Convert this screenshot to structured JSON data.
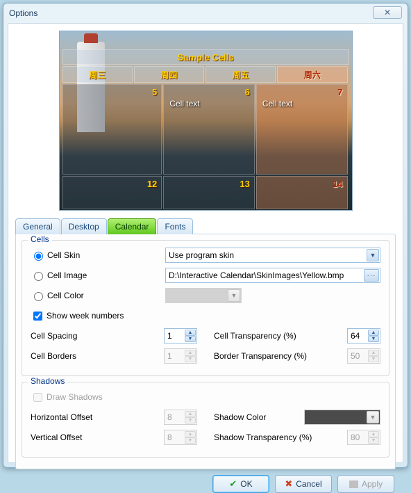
{
  "window": {
    "title": "Options",
    "close": "✕"
  },
  "preview": {
    "title": "Sample Cells",
    "day_headers": [
      "周三",
      "周四",
      "周五",
      "周六"
    ],
    "row1": [
      {
        "num": "5",
        "text": ""
      },
      {
        "num": "6",
        "text": "Cell text"
      },
      {
        "num": "7",
        "text": "Cell text"
      }
    ],
    "row2": [
      "12",
      "13",
      "14"
    ]
  },
  "tabs": {
    "general": "General",
    "desktop": "Desktop",
    "calendar": "Calendar",
    "fonts": "Fonts"
  },
  "cells": {
    "title": "Cells",
    "cell_skin_label": "Cell Skin",
    "cell_skin_value": "Use program skin",
    "cell_image_label": "Cell Image",
    "cell_image_value": "D:\\Interactive Calendar\\SkinImages\\Yellow.bmp",
    "cell_color_label": "Cell Color",
    "show_week_numbers": "Show week numbers",
    "cell_spacing_label": "Cell Spacing",
    "cell_spacing_value": "1",
    "cell_transparency_label": "Cell Transparency (%)",
    "cell_transparency_value": "64",
    "cell_borders_label": "Cell Borders",
    "cell_borders_value": "1",
    "border_transparency_label": "Border Transparency (%)",
    "border_transparency_value": "50"
  },
  "shadows": {
    "title": "Shadows",
    "draw_shadows": "Draw Shadows",
    "horizontal_offset_label": "Horizontal Offset",
    "horizontal_offset_value": "8",
    "vertical_offset_label": "Vertical Offset",
    "vertical_offset_value": "8",
    "shadow_color_label": "Shadow Color",
    "shadow_transparency_label": "Shadow Transparency (%)",
    "shadow_transparency_value": "80"
  },
  "buttons": {
    "ok": "OK",
    "cancel": "Cancel",
    "apply": "Apply"
  }
}
